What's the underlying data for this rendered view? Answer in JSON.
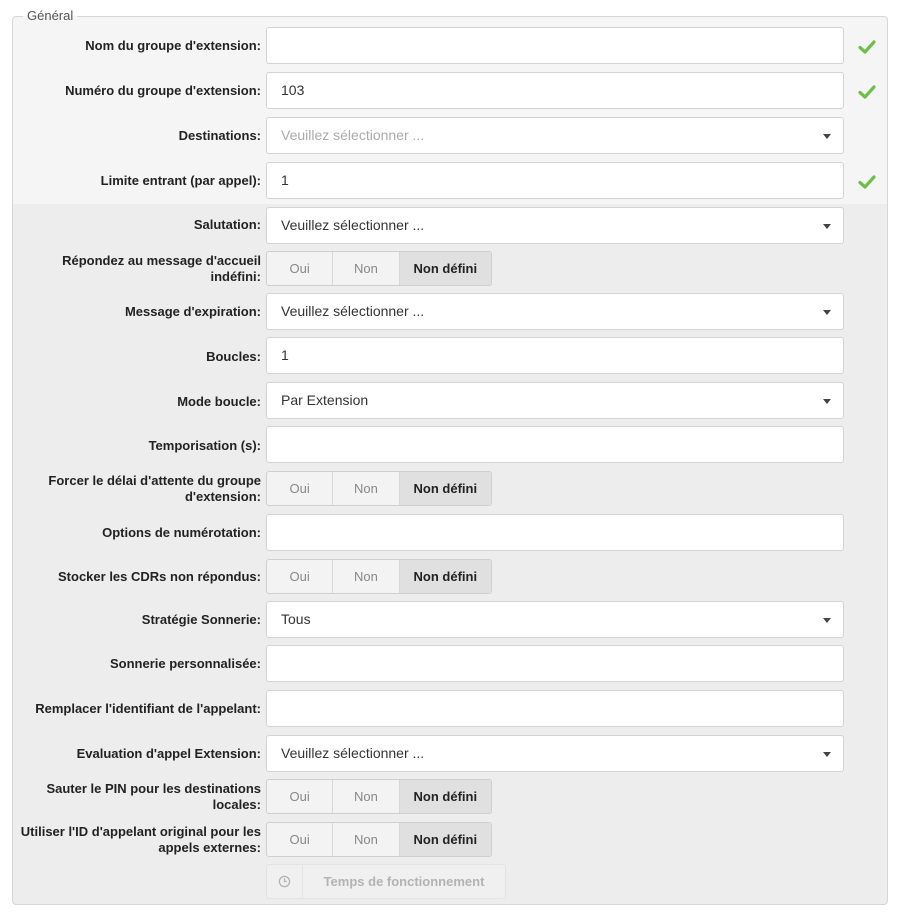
{
  "fieldset": {
    "legend": "Général"
  },
  "fields": {
    "name": {
      "label": "Nom du groupe d'extension:",
      "value": ""
    },
    "number": {
      "label": "Numéro du groupe d'extension:",
      "value": "103"
    },
    "destinations": {
      "label": "Destinations:",
      "placeholder": "Veuillez sélectionner ..."
    },
    "incoming_limit": {
      "label": "Limite entrant (par appel):",
      "value": "1"
    },
    "greeting": {
      "label": "Salutation:",
      "value": "Veuillez sélectionner ..."
    },
    "answer_greeting": {
      "label": "Répondez au message d'accueil indéfini:"
    },
    "expire_message": {
      "label": "Message d'expiration:",
      "value": "Veuillez sélectionner ..."
    },
    "loops": {
      "label": "Boucles:",
      "value": "1"
    },
    "loop_mode": {
      "label": "Mode boucle:",
      "value": "Par Extension"
    },
    "timeout": {
      "label": "Temporisation (s):",
      "value": ""
    },
    "force_timeout": {
      "label": "Forcer le délai d'attente du groupe d'extension:"
    },
    "dial_options": {
      "label": "Options de numérotation:",
      "value": ""
    },
    "store_cdrs": {
      "label": "Stocker les CDRs non répondus:"
    },
    "ring_strategy": {
      "label": "Stratégie Sonnerie:",
      "value": "Tous"
    },
    "custom_ring": {
      "label": "Sonnerie personnalisée:",
      "value": ""
    },
    "caller_id": {
      "label": "Remplacer l'identifiant de l'appelant:",
      "value": ""
    },
    "call_rating": {
      "label": "Evaluation d'appel Extension:",
      "value": "Veuillez sélectionner ..."
    },
    "skip_pin": {
      "label": "Sauter le PIN pour les destinations locales:"
    },
    "orig_callerid": {
      "label": "Utiliser l'ID d'appelant original pour les appels externes:"
    }
  },
  "toggle": {
    "yes": "Oui",
    "no": "Non",
    "undefined": "Non défini"
  },
  "uptime_button": {
    "label": "Temps de fonctionnement"
  },
  "colors": {
    "check": "#6cc04a",
    "background": "#ededed",
    "top_band": "#f5f5f5"
  }
}
